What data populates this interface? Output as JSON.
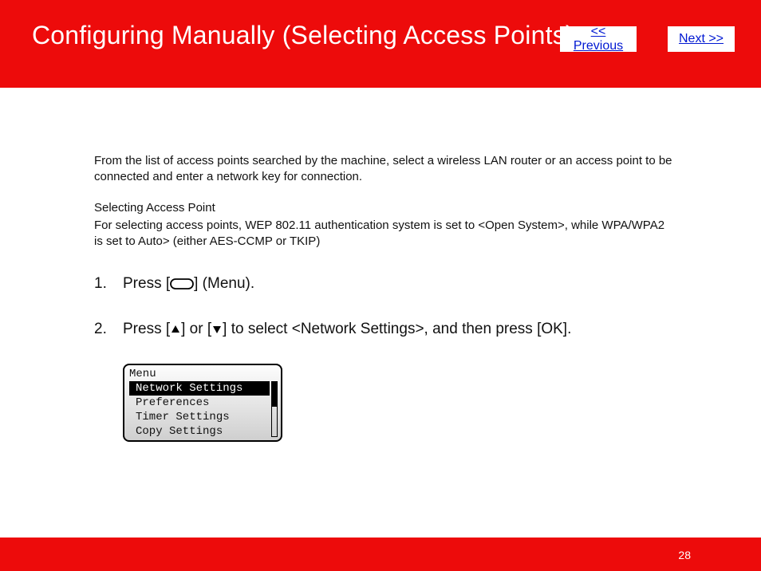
{
  "header": {
    "title": "Configuring Manually (Selecting Access Points)",
    "prev_label": "<< Previous",
    "next_label": "Next >>"
  },
  "body": {
    "intro": "From the list of access points searched by the machine, select a wireless LAN router or an access point to be connected and enter a network key for connection.",
    "sub_head": "Selecting Access Point",
    "sub_body": "For selecting access points, WEP 802.11 authentication system is set to <Open System>, while WPA/WPA2 is set to Auto> (either AES-CCMP or TKIP)",
    "steps": [
      {
        "num": "1.",
        "pre": "Press [",
        "post": "] (Menu)."
      },
      {
        "num": "2.",
        "pre": "Press [",
        "mid1": "] or [",
        "post": "] to select <Network Settings>, and then press [OK]."
      }
    ],
    "lcd": {
      "title": "Menu",
      "items": [
        {
          "label": "Network Settings",
          "selected": true
        },
        {
          "label": "Preferences",
          "selected": false
        },
        {
          "label": "Timer Settings",
          "selected": false
        },
        {
          "label": "Copy Settings",
          "selected": false
        }
      ]
    }
  },
  "footer": {
    "page_number": "28"
  },
  "colors": {
    "brand_red": "#ed0b0b",
    "link_blue": "#0018d2"
  }
}
